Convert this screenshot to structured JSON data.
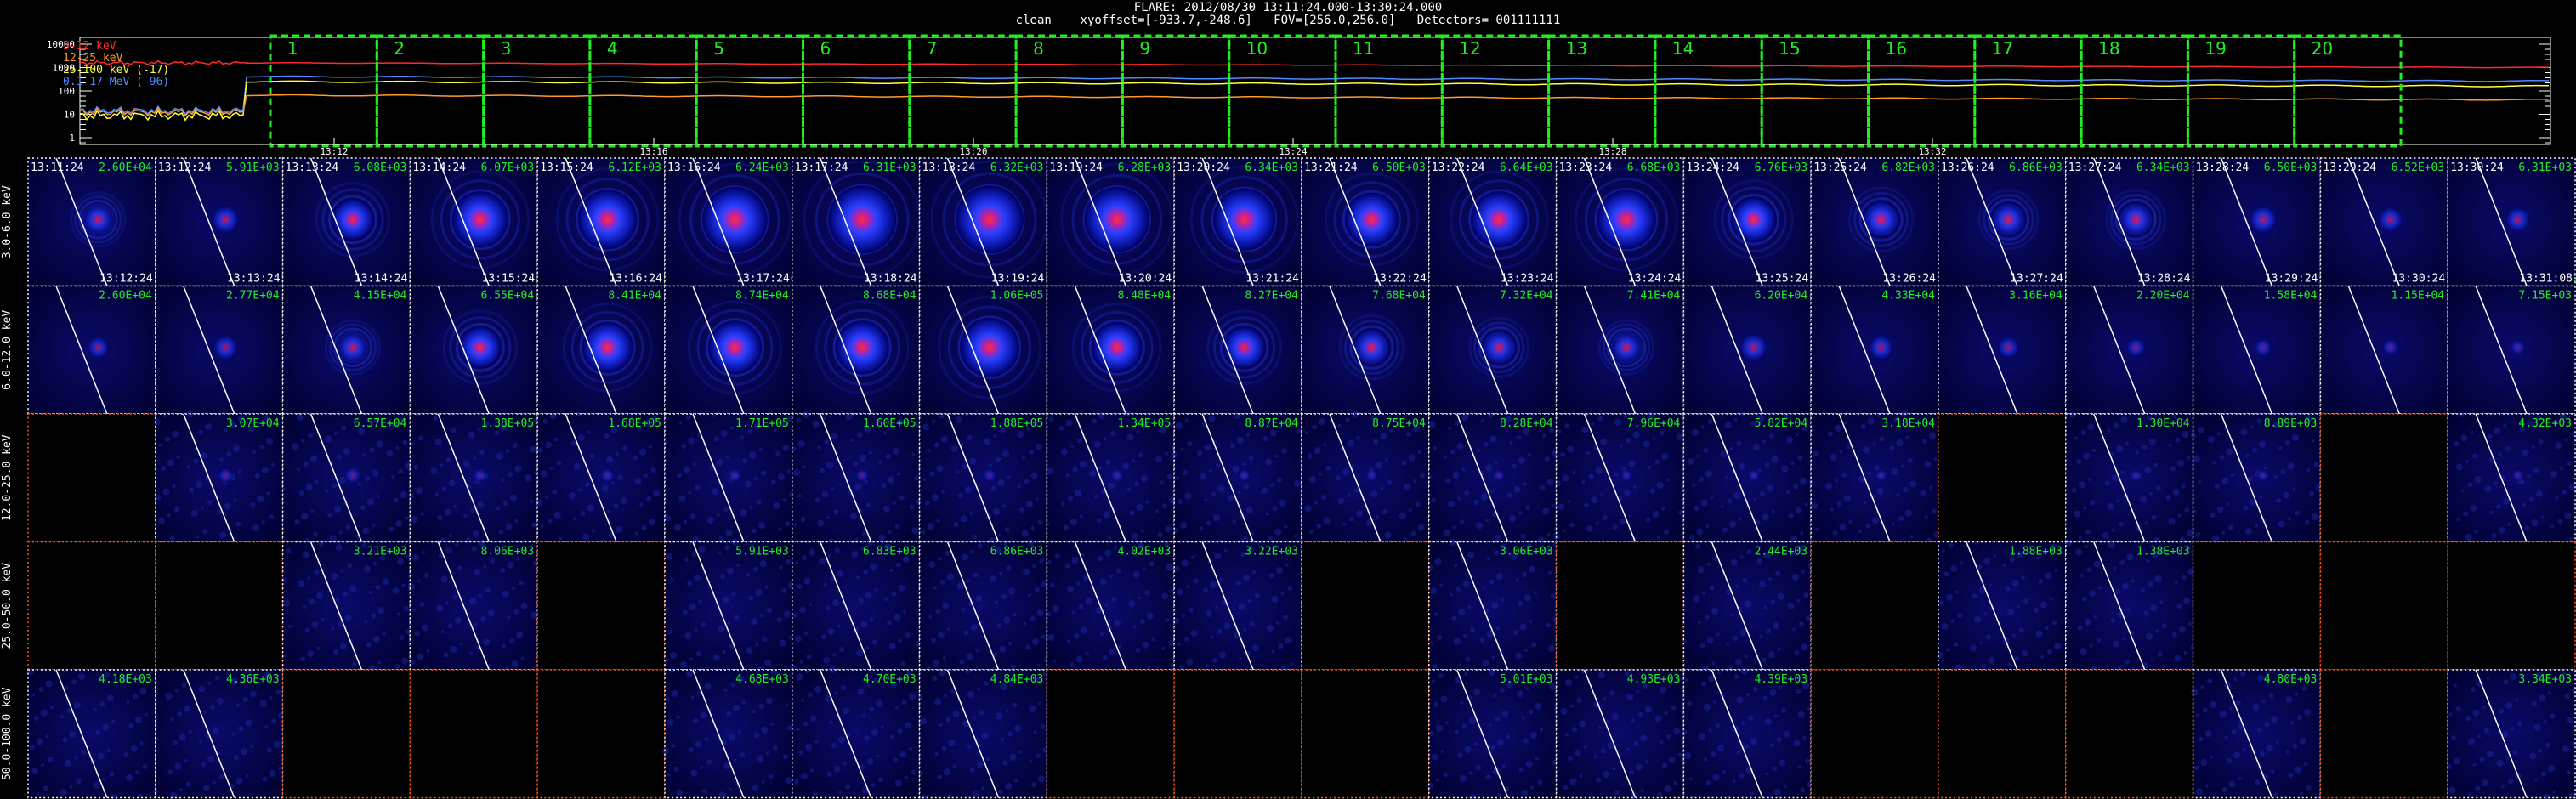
{
  "header": {
    "line1": "FLARE: 2012/08/30 13:11:24.000-13:30:24.000",
    "line2": "clean    xyoffset=[-933.7,-248.6]   FOV=[256.0,256.0]   Detectors= 001111111"
  },
  "lightcurve": {
    "y_ticks": [
      "10000",
      "1000",
      "100",
      "10",
      "1"
    ],
    "x_ticks": [
      "13:12",
      "13:16",
      "13:20",
      "13:24",
      "13:28",
      "13:32"
    ],
    "legend": [
      {
        "label": "3-12 keV",
        "color": "#ff2a2a"
      },
      {
        "label": "12-25 keV",
        "color": "#ff9a2a"
      },
      {
        "label": "25-100 keV (-17)",
        "color": "#ffff40"
      },
      {
        "label": "0.1-17 MeV (-96)",
        "color": "#4a8cff"
      }
    ],
    "interval_labels": [
      "1",
      "2",
      "3",
      "4",
      "5",
      "6",
      "7",
      "8",
      "9",
      "10",
      "11",
      "12",
      "13",
      "14",
      "15",
      "16",
      "17",
      "18",
      "19",
      "20"
    ],
    "box_color": "#22ee22"
  },
  "row_labels": [
    "3.0-6.0 keV",
    "6.0-12.0 keV",
    "12.0-25.0 keV",
    "25.0-50.0 keV",
    "50.0-100.0 keV"
  ],
  "start_times": [
    "13:11:24",
    "13:12:24",
    "13:13:24",
    "13:14:24",
    "13:15:24",
    "13:16:24",
    "13:17:24",
    "13:18:24",
    "13:19:24",
    "13:20:24",
    "13:21:24",
    "13:22:24",
    "13:23:24",
    "13:24:24",
    "13:25:24",
    "13:26:24",
    "13:27:24",
    "13:28:24",
    "13:29:24",
    "13:30:24"
  ],
  "end_times": [
    "13:12:24",
    "13:13:24",
    "13:14:24",
    "13:15:24",
    "13:16:24",
    "13:17:24",
    "13:18:24",
    "13:19:24",
    "13:20:24",
    "13:21:24",
    "13:22:24",
    "13:23:24",
    "13:24:24",
    "13:25:24",
    "13:26:24",
    "13:27:24",
    "13:28:24",
    "13:29:24",
    "13:30:24",
    "13:31:08"
  ],
  "values": [
    [
      "2.60E+04",
      "5.91E+03",
      "6.08E+03",
      "6.07E+03",
      "6.12E+03",
      "6.24E+03",
      "6.31E+03",
      "6.32E+03",
      "6.28E+03",
      "6.34E+03",
      "6.50E+03",
      "6.64E+03",
      "6.68E+03",
      "6.76E+03",
      "6.82E+03",
      "6.86E+03",
      "6.34E+03",
      "6.50E+03",
      "6.52E+03",
      "6.31E+03"
    ],
    [
      "2.60E+04",
      "2.77E+04",
      "4.15E+04",
      "6.55E+04",
      "8.41E+04",
      "8.74E+04",
      "8.68E+04",
      "1.06E+05",
      "8.48E+04",
      "8.27E+04",
      "7.68E+04",
      "7.32E+04",
      "7.41E+04",
      "6.20E+04",
      "4.33E+04",
      "3.16E+04",
      "2.20E+04",
      "1.58E+04",
      "1.15E+04",
      "7.15E+03"
    ],
    [
      "",
      "3.07E+04",
      "6.57E+04",
      "1.38E+05",
      "1.68E+05",
      "1.71E+05",
      "1.60E+05",
      "1.88E+05",
      "1.34E+05",
      "8.87E+04",
      "8.75E+04",
      "8.28E+04",
      "7.96E+04",
      "5.82E+04",
      "3.18E+04",
      "",
      "1.30E+04",
      "8.89E+03",
      "",
      "4.32E+03"
    ],
    [
      "",
      "",
      "3.21E+03",
      "8.06E+03",
      "",
      "5.91E+03",
      "6.83E+03",
      "6.86E+03",
      "4.02E+03",
      "3.22E+03",
      "",
      "3.06E+03",
      "",
      "2.44E+03",
      "",
      "1.88E+03",
      "1.38E+03",
      "",
      "",
      ""
    ],
    [
      "4.18E+03",
      "4.36E+03",
      "",
      "",
      "",
      "4.68E+03",
      "4.70E+03",
      "4.84E+03",
      "",
      "",
      "",
      "5.01E+03",
      "4.93E+03",
      "4.39E+03",
      "",
      "",
      "",
      "4.80E+03",
      "",
      "3.34E+03"
    ]
  ],
  "intensity": [
    [
      0.35,
      0.3,
      0.55,
      0.8,
      0.85,
      0.95,
      1.0,
      1.0,
      0.95,
      0.9,
      0.75,
      0.8,
      0.85,
      0.6,
      0.45,
      0.4,
      0.4,
      0.3,
      0.25,
      0.25
    ],
    [
      0.2,
      0.25,
      0.35,
      0.55,
      0.7,
      0.75,
      0.75,
      0.85,
      0.7,
      0.55,
      0.45,
      0.4,
      0.35,
      0.3,
      0.25,
      0.2,
      0.15,
      0.12,
      0.1,
      0.08
    ],
    [
      0,
      0.08,
      0.1,
      0.06,
      0.06,
      0.05,
      0.05,
      0.05,
      0.04,
      0.03,
      0.02,
      0.02,
      0.02,
      0.02,
      0.02,
      0,
      0.02,
      0.02,
      0,
      0.02
    ],
    [
      0,
      0,
      0,
      0,
      0,
      0,
      0,
      0,
      0,
      0,
      0,
      0,
      0,
      0,
      0,
      0,
      0,
      0,
      0,
      0
    ],
    [
      0,
      0,
      0,
      0,
      0,
      0,
      0,
      0,
      0,
      0,
      0,
      0,
      0,
      0,
      0,
      0,
      0,
      0,
      0,
      0
    ]
  ],
  "colors": {
    "value_text": "#22ee22",
    "label_text": "#ffffff",
    "blank_frame": "#ff5a1a",
    "frame": "#ffffff"
  }
}
